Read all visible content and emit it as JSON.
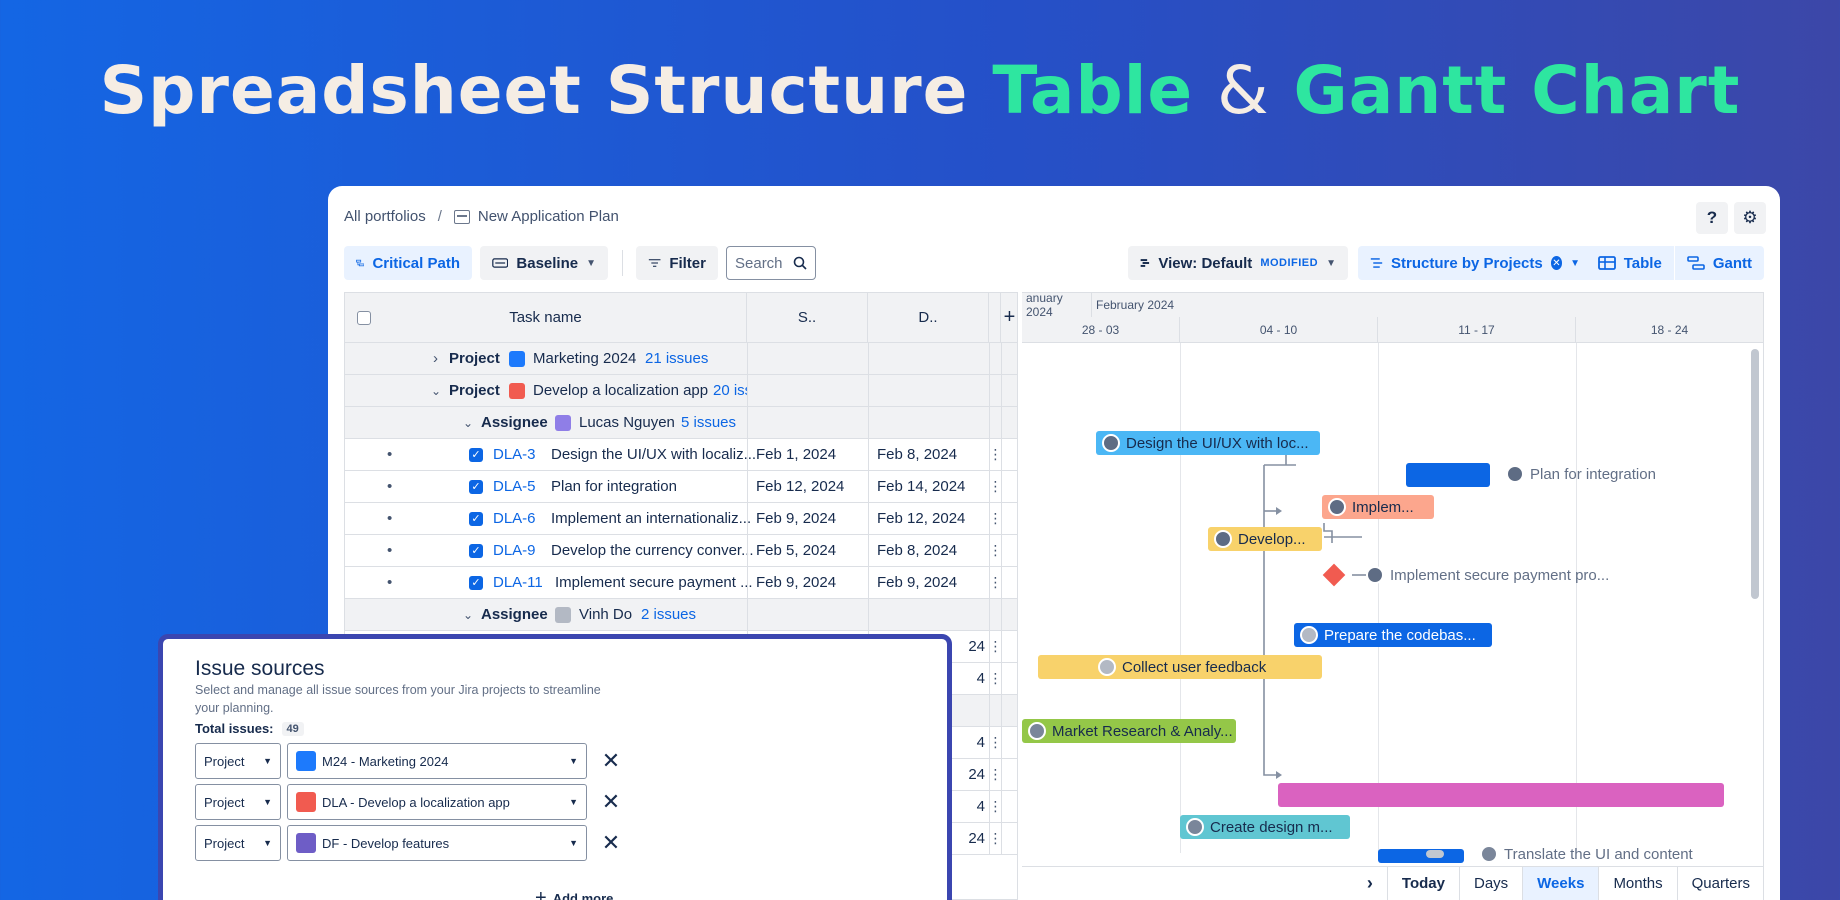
{
  "hero": {
    "part1": "Spreadsheet Structure",
    "part2": "Table",
    "amp": "&",
    "part3": "Gantt Chart"
  },
  "breadcrumb": {
    "root": "All portfolios",
    "sep": "/",
    "current": "New Application Plan"
  },
  "top_icons": {
    "help": "?",
    "settings": "⚙"
  },
  "toolbar": {
    "critical_path": "Critical Path",
    "baseline": "Baseline",
    "filter": "Filter",
    "search_placeholder": "Search",
    "view_label": "View: Default",
    "modified": "MODIFIED",
    "structure": "Structure by Projects",
    "table": "Table",
    "gantt": "Gantt"
  },
  "table": {
    "headers": {
      "task": "Task name",
      "start": "S..",
      "due": "D..",
      "add": "+"
    },
    "groups": [
      {
        "kind": "Project",
        "name": "Marketing 2024",
        "count": "21 issues"
      },
      {
        "kind": "Project",
        "name": "Develop a localization app",
        "count": "20 iss"
      },
      {
        "kind": "Assignee",
        "name": "Lucas Nguyen",
        "count": "5 issues"
      },
      {
        "kind": "Assignee",
        "name": "Vinh Do",
        "count": "2 issues"
      }
    ],
    "rows": [
      {
        "key": "DLA-3",
        "summary": "Design the UI/UX with localiz...",
        "start": "Feb 1, 2024",
        "due": "Feb 8, 2024"
      },
      {
        "key": "DLA-5",
        "summary": "Plan for integration",
        "start": "Feb 12, 2024",
        "due": "Feb 14, 2024"
      },
      {
        "key": "DLA-6",
        "summary": "Implement an internationaliz...",
        "start": "Feb 9, 2024",
        "due": "Feb 12, 2024"
      },
      {
        "key": "DLA-9",
        "summary": "Develop the currency conver...",
        "start": "Feb 5, 2024",
        "due": "Feb 8, 2024"
      },
      {
        "key": "DLA-11",
        "summary": "Implement secure payment ...",
        "start": "Feb 9, 2024",
        "due": "Feb 9, 2024"
      }
    ],
    "partial_dates": [
      "24",
      "4",
      "4",
      "24",
      "4",
      "24"
    ]
  },
  "gantt": {
    "months": [
      "anuary 2024",
      "February 2024"
    ],
    "weeks": [
      "28 - 03",
      "04 - 10",
      "11 - 17",
      "18 - 24"
    ],
    "bars": {
      "design": "Design the UI/UX with loc...",
      "plan": "Plan for integration",
      "implem": "Implem...",
      "develop": "Develop...",
      "secure": "Implement secure payment pro...",
      "prepare": "Prepare the codebas...",
      "collect": "Collect user feedback",
      "market": "Market Research & Analy...",
      "create": "Create design m...",
      "translate": "Translate the UI and content"
    },
    "colors": {
      "blue": "#4bb7f5",
      "darkblue": "#0c66e4",
      "salmon": "#fca68d",
      "yellow": "#f8d26b",
      "red": "#f15b50",
      "green": "#94c748",
      "teal": "#60c6d2",
      "pink": "#da62c0"
    },
    "footer": {
      "today": "Today",
      "days": "Days",
      "weeks": "Weeks",
      "months": "Months",
      "quarters": "Quarters",
      "next": "›"
    }
  },
  "issue_sources": {
    "title": "Issue sources",
    "description": "Select and manage all issue sources from your Jira projects to streamline your planning.",
    "total_label": "Total issues:",
    "total": "49",
    "sources": [
      {
        "type": "Project",
        "name": "M24 - Marketing 2024",
        "icon_color": "#1d7afc"
      },
      {
        "type": "Project",
        "name": "DLA - Develop a localization app",
        "icon_color": "#f15b50"
      },
      {
        "type": "Project",
        "name": "DF - Develop features",
        "icon_color": "#6e5dc6"
      }
    ],
    "add_more": "Add more"
  }
}
